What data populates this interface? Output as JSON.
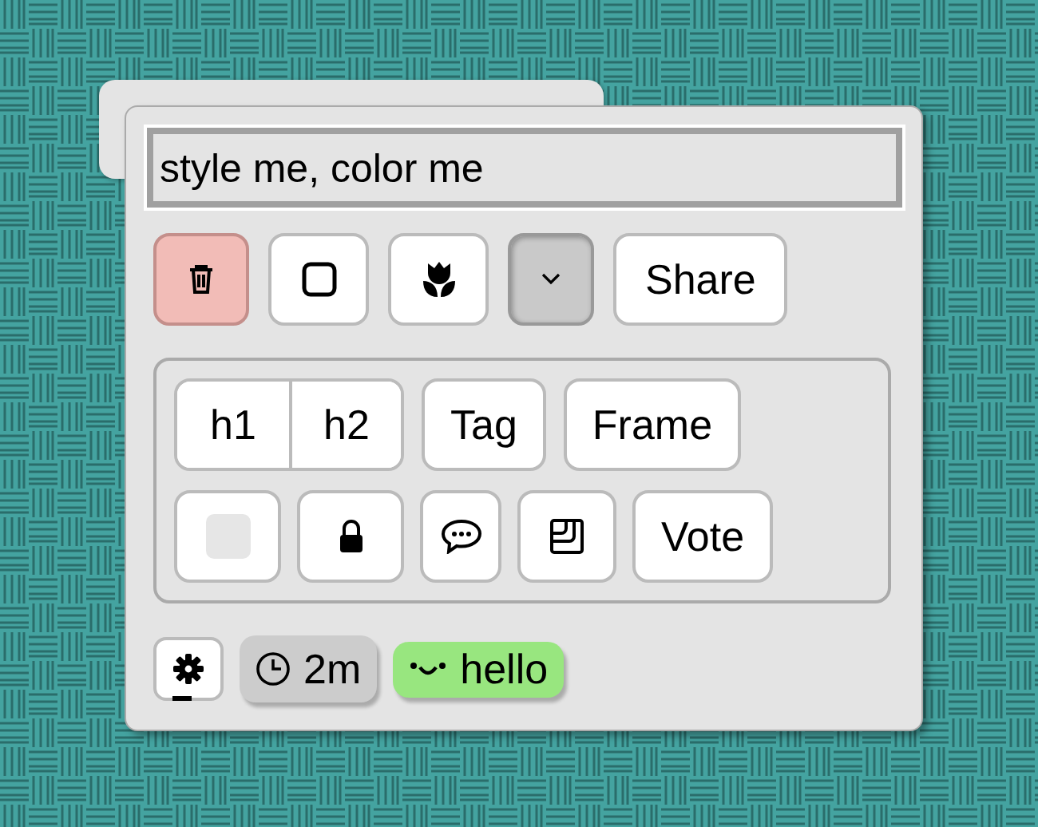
{
  "editor": {
    "value": "style me, color me"
  },
  "toolbar": [
    {
      "kind": "danger",
      "pressed": false
    },
    {
      "kind": "plain",
      "pressed": false
    },
    {
      "kind": "plain",
      "pressed": false
    },
    {
      "kind": "menu",
      "pressed": true
    },
    {
      "kind": "text",
      "label": "Share",
      "pressed": false
    }
  ],
  "group": {
    "rows": [
      [
        {
          "kind": "split",
          "labels": [
            "h1",
            "h2"
          ]
        },
        {
          "kind": "text",
          "label": "Tag"
        },
        {
          "kind": "text",
          "label": "Frame"
        }
      ],
      [
        {
          "kind": "swatch"
        },
        {
          "kind": "lock"
        },
        {
          "kind": "comment"
        },
        {
          "kind": "sticker"
        },
        {
          "kind": "text",
          "label": "Vote"
        }
      ]
    ]
  },
  "footer": {
    "chips": [
      {
        "kind": "timer",
        "label": "2m",
        "color": "#cccccc"
      },
      {
        "kind": "status",
        "label": "hello",
        "color": "#98e67f"
      }
    ]
  }
}
